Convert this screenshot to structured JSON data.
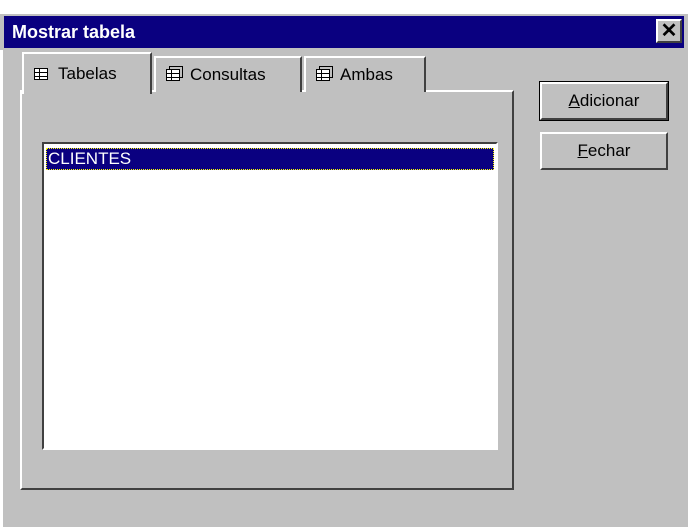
{
  "window": {
    "title": "Mostrar tabela",
    "close_glyph": "✕"
  },
  "tabs": [
    {
      "label": "Tabelas",
      "icon": "table-icon",
      "active": true
    },
    {
      "label": "Consultas",
      "icon": "query-icon",
      "active": false
    },
    {
      "label": "Ambas",
      "icon": "both-icon",
      "active": false
    }
  ],
  "list": {
    "items": [
      {
        "label": "CLIENTES",
        "selected": true
      }
    ]
  },
  "buttons": {
    "add": {
      "accel": "A",
      "rest": "dicionar"
    },
    "close": {
      "accel": "F",
      "rest": "echar"
    }
  },
  "colors": {
    "titlebar": "#0a0080",
    "face": "#c0c0c0",
    "selection": "#0a0080"
  }
}
